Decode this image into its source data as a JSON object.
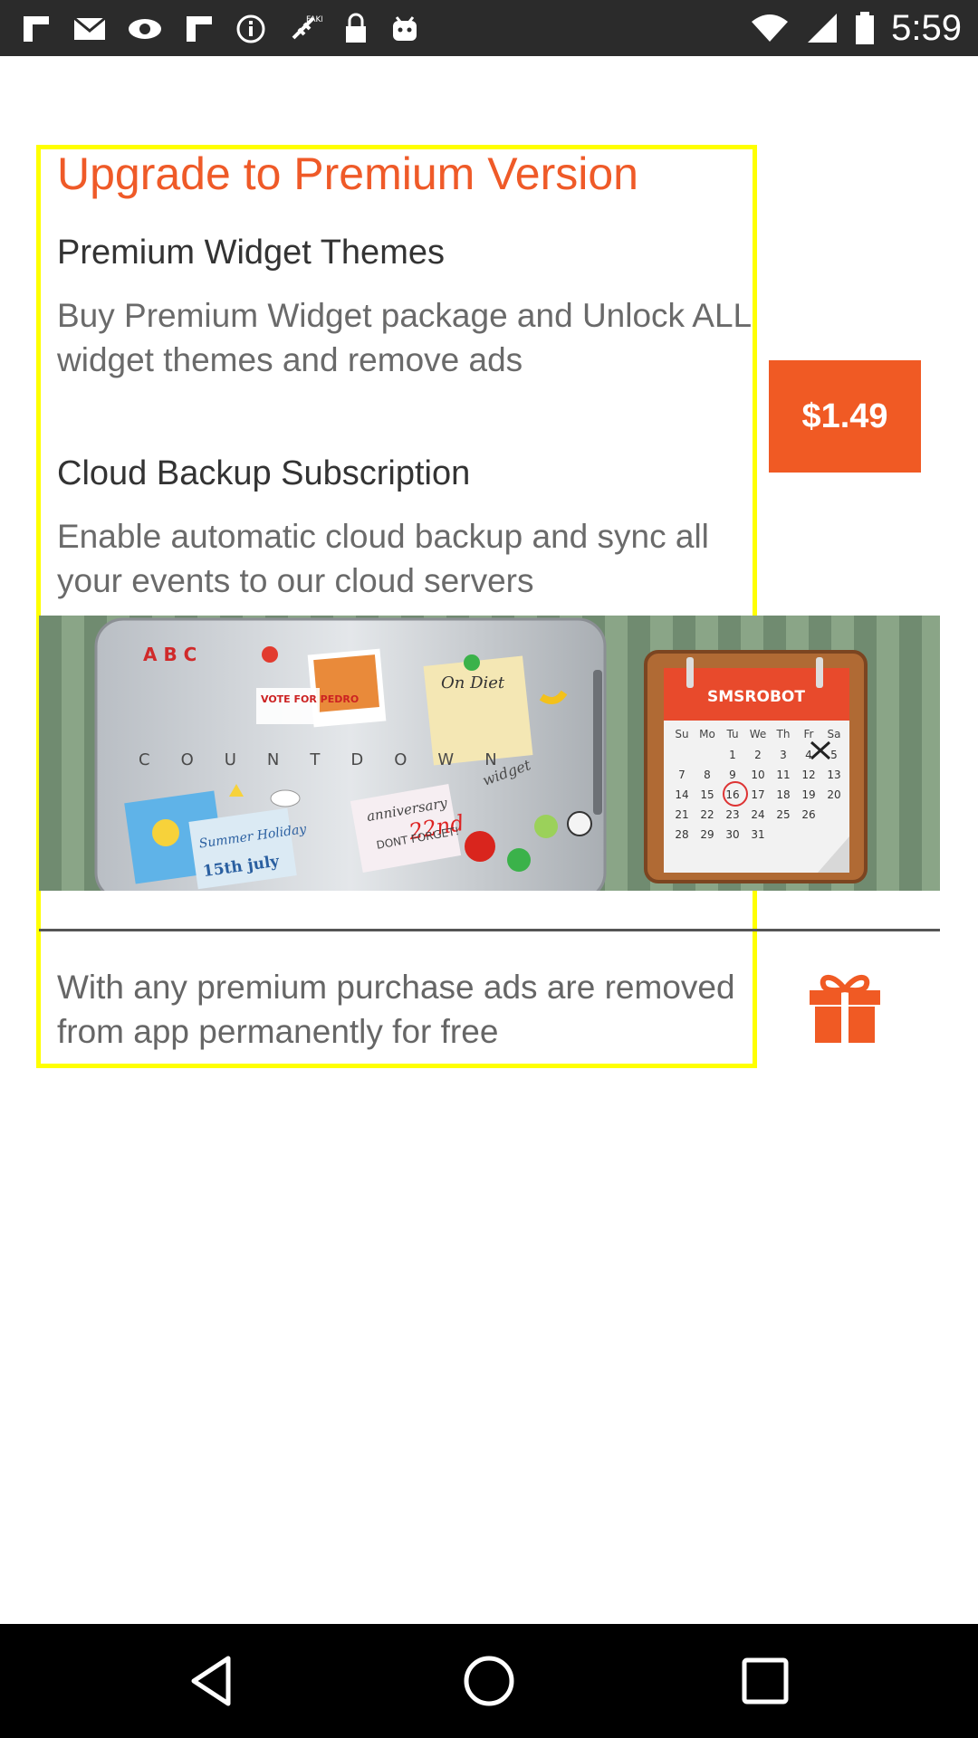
{
  "status_bar": {
    "time": "5:59",
    "icons": [
      "flipboard-icon",
      "gmail-icon",
      "eye-icon",
      "flipboard-icon",
      "info-icon",
      "fake-gps-icon",
      "lock-icon",
      "android-icon",
      "wifi-icon",
      "signal-icon",
      "battery-icon"
    ]
  },
  "upgrade": {
    "title": "Upgrade to Premium Version",
    "widget_title": "Premium Widget Themes",
    "widget_desc": "Buy Premium Widget package and Unlock ALL widget themes and remove ads",
    "price": "$1.49",
    "cloud_title": "Cloud Backup Subscription",
    "cloud_desc": "Enable automatic cloud backup and sync all your events to our cloud servers"
  },
  "banner": {
    "magnet_letters": "A B C",
    "vote_note": "VOTE FOR PEDRO",
    "diet_note": "On Diet",
    "countdown_text": "COUNTDOWN",
    "widget_label": "widget",
    "holiday_note": "Summer Holiday",
    "holiday_date": "15th july",
    "anniversary_note": "anniversary",
    "anniversary_date": "22nd",
    "dont_forget": "DONT FORGET!",
    "calendar_brand": "SMSROBOT",
    "calendar_days": [
      "Su",
      "Mo",
      "Tu",
      "We",
      "Th",
      "Fr",
      "Sa"
    ],
    "calendar_rows": [
      [
        "",
        "",
        "1",
        "2",
        "3",
        "4",
        "5"
      ],
      [
        "7",
        "8",
        "9",
        "10",
        "11",
        "12",
        "13"
      ],
      [
        "14",
        "15",
        "16",
        "17",
        "18",
        "19",
        "20"
      ],
      [
        "21",
        "22",
        "23",
        "24",
        "25",
        "26",
        ""
      ],
      [
        "28",
        "29",
        "30",
        "31",
        "",
        "",
        ""
      ]
    ]
  },
  "footer": {
    "note": "With any premium purchase ads are removed from app permanently for free"
  },
  "colors": {
    "accent": "#f05a24",
    "highlight_border": "#ffff00"
  }
}
